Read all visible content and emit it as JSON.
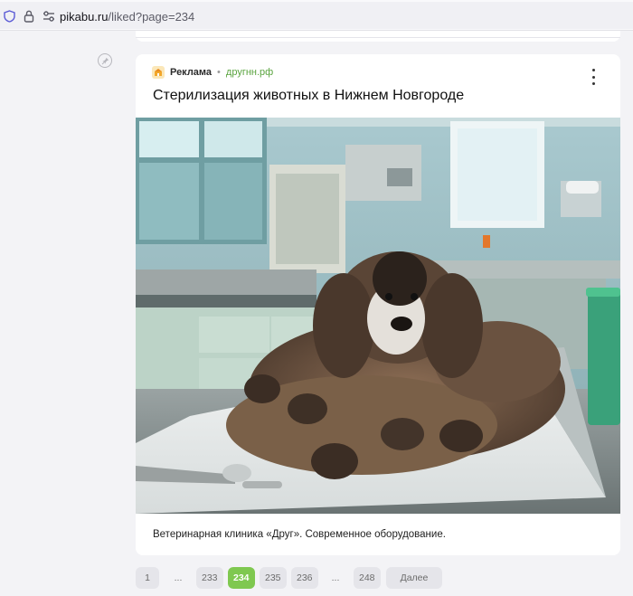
{
  "browser": {
    "url_host": "pikabu.ru",
    "url_path": "/liked?page=234"
  },
  "ad_card": {
    "label": "Реклама",
    "separator": "•",
    "site": "другнн.рф",
    "title": "Стерилизация животных в Нижнем Новгороде",
    "caption": "Ветеринарная клиника «Друг». Современное оборудование."
  },
  "pagination": {
    "items": [
      {
        "label": "1"
      },
      {
        "label": "..."
      },
      {
        "label": "233"
      },
      {
        "label": "234"
      },
      {
        "label": "235"
      },
      {
        "label": "236"
      },
      {
        "label": "..."
      },
      {
        "label": "248"
      }
    ],
    "next_label": "Далее",
    "active": "234"
  },
  "colors": {
    "accent": "#7fc850",
    "site_link": "#5aa43f"
  },
  "icons": {
    "shield": "shield-icon",
    "lock": "lock-icon",
    "permissions": "permissions-icon",
    "pin": "pin-icon",
    "more": "more-vertical-icon"
  }
}
